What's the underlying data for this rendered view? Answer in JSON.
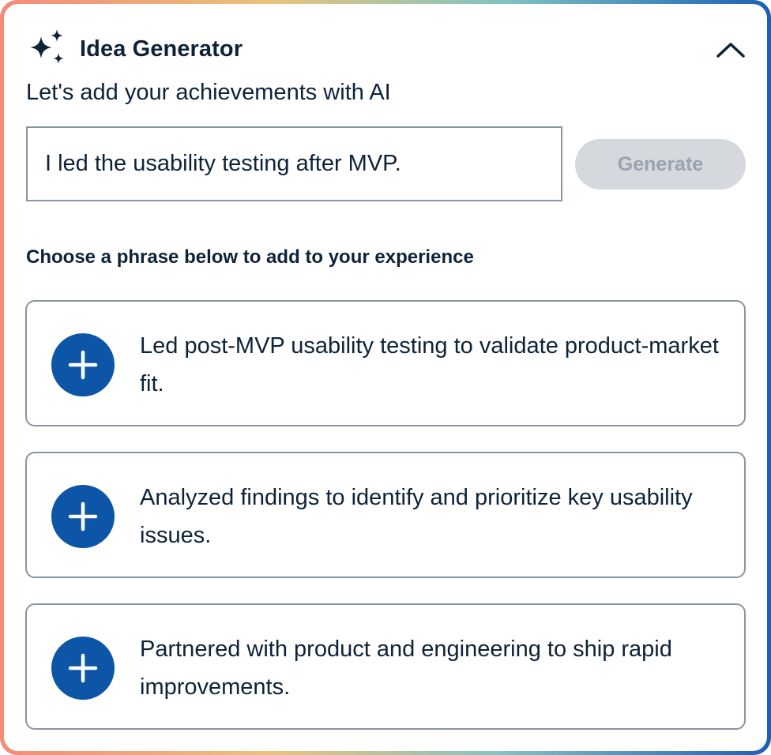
{
  "header": {
    "title": "Idea Generator",
    "icon": "sparkles-icon",
    "collapse_icon": "chevron-up-icon"
  },
  "subtitle": "Let's add your achievements with AI",
  "input": {
    "value": "I led the usability testing after MVP.",
    "placeholder": ""
  },
  "generate_button": {
    "label": "Generate",
    "state": "disabled"
  },
  "section_label": "Choose a phrase below to add to your experience",
  "suggestions": [
    {
      "text": "Led post-MVP usability testing to validate product-market fit.",
      "icon": "plus-icon"
    },
    {
      "text": "Analyzed findings to identify and prioritize key usability issues.",
      "icon": "plus-icon"
    },
    {
      "text": "Partnered with product and engineering to ship rapid improvements.",
      "icon": "plus-icon"
    }
  ],
  "colors": {
    "text": "#0e2238",
    "accent": "#0d55a6",
    "border": "#8995a4",
    "button_disabled_bg": "#d5d9de",
    "button_disabled_text": "#9aa3ad",
    "gradient": [
      "#f58a78",
      "#e9c37c",
      "#82c4c2",
      "#1c5fb8"
    ]
  }
}
